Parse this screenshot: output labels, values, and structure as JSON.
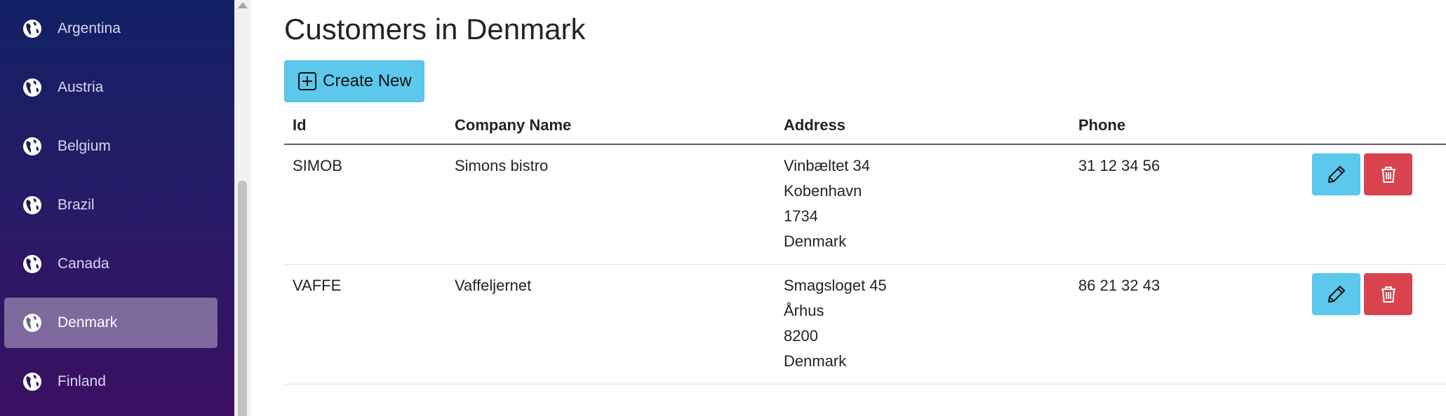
{
  "sidebar": {
    "items": [
      {
        "label": "Argentina",
        "icon": "globe-icon",
        "active": false
      },
      {
        "label": "Austria",
        "icon": "globe-icon",
        "active": false
      },
      {
        "label": "Belgium",
        "icon": "globe-icon",
        "active": false
      },
      {
        "label": "Brazil",
        "icon": "globe-icon",
        "active": false
      },
      {
        "label": "Canada",
        "icon": "globe-icon",
        "active": false
      },
      {
        "label": "Denmark",
        "icon": "globe-icon",
        "active": true
      },
      {
        "label": "Finland",
        "icon": "globe-icon",
        "active": false
      }
    ]
  },
  "main": {
    "title": "Customers in Denmark",
    "create_label": "Create New",
    "table": {
      "headers": {
        "id": "Id",
        "company": "Company Name",
        "address": "Address",
        "phone": "Phone"
      },
      "rows": [
        {
          "id": "SIMOB",
          "company": "Simons bistro",
          "address": {
            "street": "Vinbæltet 34",
            "city": "Kobenhavn",
            "postal": "1734",
            "country": "Denmark"
          },
          "phone": "31 12 34 56"
        },
        {
          "id": "VAFFE",
          "company": "Vaffeljernet",
          "address": {
            "street": "Smagsloget 45",
            "city": "Århus",
            "postal": "8200",
            "country": "Denmark"
          },
          "phone": "86 21 32 43"
        }
      ]
    }
  },
  "colors": {
    "sidebar_top": "#112163",
    "sidebar_bottom": "#3a0f62",
    "active_item": "#7b7298",
    "primary_button": "#5bc8ec",
    "danger_button": "#d9434e"
  }
}
